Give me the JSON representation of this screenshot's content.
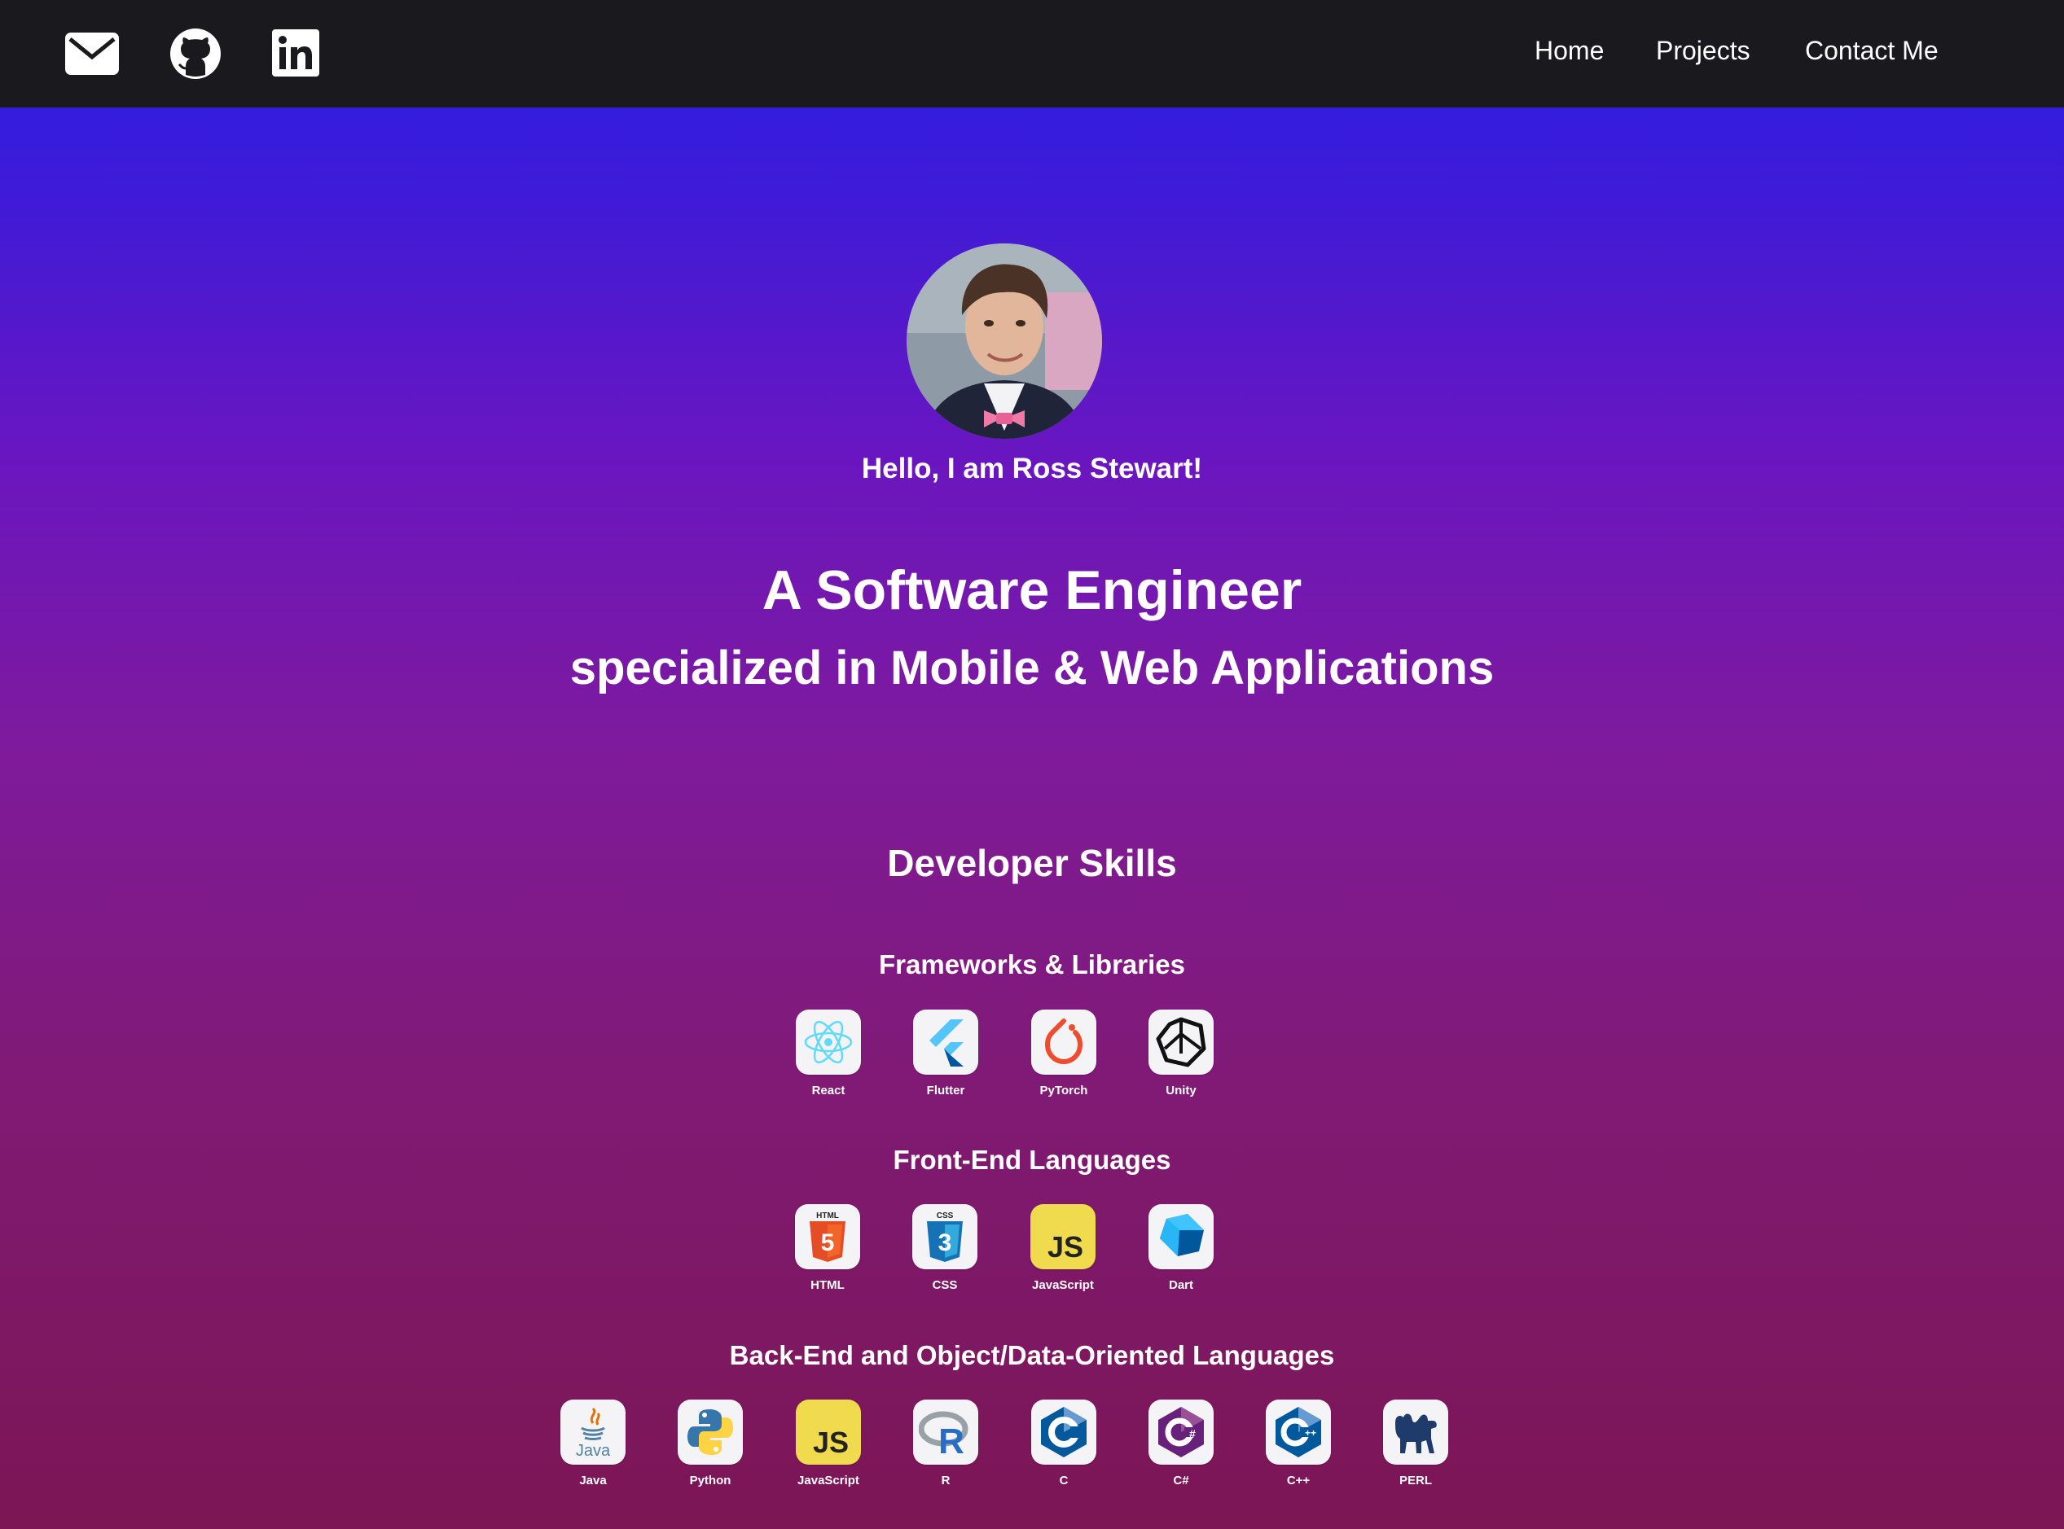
{
  "nav": {
    "icons": [
      "mail-icon",
      "github-icon",
      "linkedin-icon"
    ],
    "links": [
      "Home",
      "Projects",
      "Contact Me"
    ]
  },
  "hero": {
    "greeting": "Hello, I am Ross Stewart!",
    "title": "A Software Engineer",
    "subtitle": "specialized in Mobile & Web Applications"
  },
  "skills": {
    "heading": "Developer Skills",
    "categories": [
      {
        "title": "Frameworks & Libraries",
        "items": [
          {
            "label": "React",
            "icon": "react-icon"
          },
          {
            "label": "Flutter",
            "icon": "flutter-icon"
          },
          {
            "label": "PyTorch",
            "icon": "pytorch-icon"
          },
          {
            "label": "Unity",
            "icon": "unity-icon"
          }
        ]
      },
      {
        "title": "Front-End Languages",
        "items": [
          {
            "label": "HTML",
            "icon": "html5-icon"
          },
          {
            "label": "CSS",
            "icon": "css3-icon"
          },
          {
            "label": "JavaScript",
            "icon": "javascript-icon"
          },
          {
            "label": "Dart",
            "icon": "dart-icon"
          }
        ]
      },
      {
        "title": "Back-End and Object/Data-Oriented Languages",
        "items": [
          {
            "label": "Java",
            "icon": "java-icon"
          },
          {
            "label": "Python",
            "icon": "python-icon"
          },
          {
            "label": "JavaScript",
            "icon": "javascript-icon"
          },
          {
            "label": "R",
            "icon": "r-icon"
          },
          {
            "label": "C",
            "icon": "c-icon"
          },
          {
            "label": "C#",
            "icon": "csharp-icon"
          },
          {
            "label": "C++",
            "icon": "cpp-icon"
          },
          {
            "label": "PERL",
            "icon": "perl-icon"
          }
        ]
      }
    ]
  },
  "colors": {
    "navbar": "#1a1a1e",
    "gradient_top": "#2a1de6",
    "gradient_bottom": "#7c1654"
  }
}
